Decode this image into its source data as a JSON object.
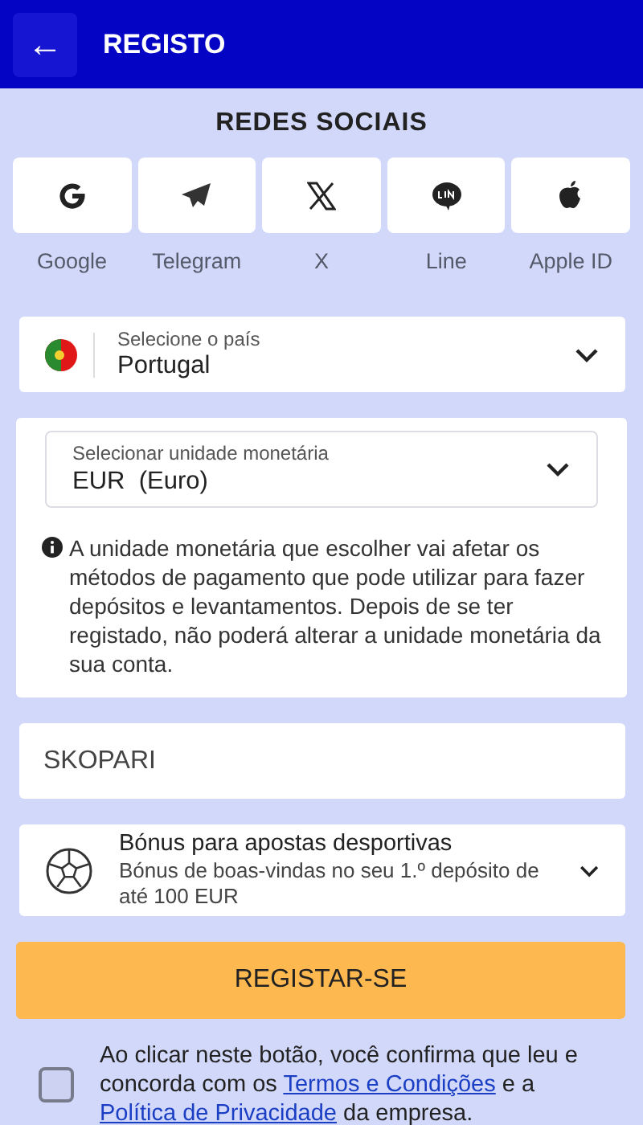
{
  "header": {
    "back_icon": "←",
    "title": "REGISTO"
  },
  "social": {
    "title": "REDES SOCIAIS",
    "providers": [
      {
        "kind": "google",
        "label": "Google"
      },
      {
        "kind": "telegram",
        "label": "Telegram"
      },
      {
        "kind": "x",
        "label": "X"
      },
      {
        "kind": "line",
        "label": "Line"
      },
      {
        "kind": "apple",
        "label": "Apple ID"
      }
    ]
  },
  "country": {
    "label": "Selecione o país",
    "value": "Portugal"
  },
  "currency": {
    "label": "Selecionar unidade monetária",
    "value": "EUR  (Euro)",
    "note": "A unidade monetária que escolher vai afetar os métodos de pagamento que pode utilizar para fazer depósitos e levantamentos. Depois de se ter registado, não poderá alterar a unidade monetária da sua conta."
  },
  "promo": {
    "value": "SKOPARI"
  },
  "bonus": {
    "title": "Bónus para apostas desportivas",
    "description": "Bónus de boas-vindas no seu 1.º depósito de até 100 EUR"
  },
  "register_button": "REGISTAR-SE",
  "consent": {
    "checked": false,
    "before": "Ao clicar neste botão, você confirma que leu e concorda com os ",
    "terms_link": "Termos e Condições",
    "middle": " e a ",
    "privacy_link": "Política de Privacidade",
    "after": " da empresa."
  }
}
